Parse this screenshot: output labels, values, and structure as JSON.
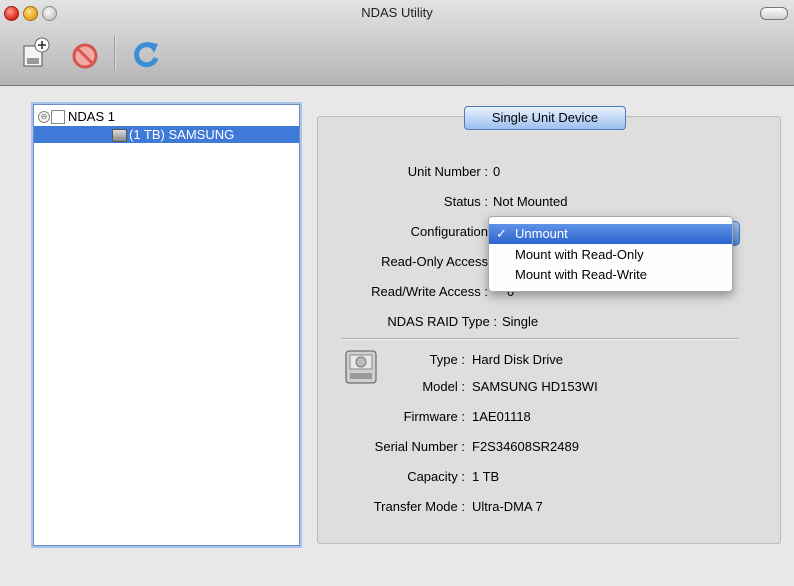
{
  "window": {
    "title": "NDAS Utility"
  },
  "toolbar": {
    "buttons": [
      {
        "name": "add-device",
        "icon": "add-device-icon"
      },
      {
        "name": "remove-device",
        "icon": "prohibited-icon"
      },
      {
        "name": "refresh",
        "icon": "refresh-icon"
      }
    ]
  },
  "sidebar": {
    "items": [
      {
        "label": "NDAS 1",
        "level": 0,
        "selected": false
      },
      {
        "label": "(1 TB) SAMSUNG",
        "level": 1,
        "selected": true
      }
    ]
  },
  "panel": {
    "tab_label": "Single Unit Device",
    "unit_number": {
      "label": "Unit Number",
      "value": "0"
    },
    "status": {
      "label": "Status",
      "value": "Not Mounted"
    },
    "configuration": {
      "label": "Configuration"
    },
    "read_only_access": {
      "label": "Read-Only Access",
      "value": ""
    },
    "read_write_access": {
      "label": "Read/Write Access",
      "value": "0"
    },
    "raid_type": {
      "label": "NDAS RAID Type",
      "value": "Single"
    },
    "disk": {
      "type": {
        "label": "Type",
        "value": "Hard Disk Drive"
      },
      "model": {
        "label": "Model",
        "value": "SAMSUNG HD153WI"
      },
      "firmware": {
        "label": "Firmware",
        "value": "1AE01118"
      },
      "serial": {
        "label": "Serial Number",
        "value": "F2S34608SR2489"
      },
      "capacity": {
        "label": "Capacity",
        "value": "1 TB"
      },
      "transfer_mode": {
        "label": "Transfer Mode",
        "value": "Ultra-DMA 7"
      }
    }
  },
  "config_menu": {
    "selected_check": "✓",
    "options": [
      "Unmount",
      "Mount with Read-Only",
      "Mount with Read-Write"
    ],
    "selected_index": 0
  },
  "colors": {
    "accent": "#3f7ad8",
    "selection": "#2d64cf"
  }
}
